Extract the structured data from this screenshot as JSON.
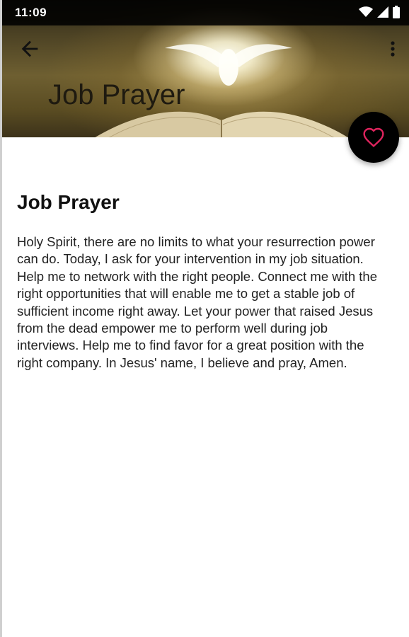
{
  "status_bar": {
    "time": "11:09",
    "icons": [
      "wifi-icon",
      "signal-icon",
      "battery-icon"
    ]
  },
  "toolbar": {
    "back_icon": "arrow-back-icon",
    "menu_icon": "more-vert-icon",
    "title": "Job Prayer"
  },
  "favorite": {
    "icon": "heart-outline-icon",
    "accent_color": "#e0245e"
  },
  "article": {
    "title": "Job Prayer",
    "body": "Holy Spirit, there are no limits to what your resurrection power can do. Today, I ask for your intervention in my job situation. Help me to network with the right people. Connect me with the right opportunities that will enable me to get a stable job of sufficient income right away. Let your power that raised Jesus from the dead empower me to perform well during job interviews. Help me to find favor for a great position with the right company. In Jesus' name, I believe and pray, Amen."
  }
}
